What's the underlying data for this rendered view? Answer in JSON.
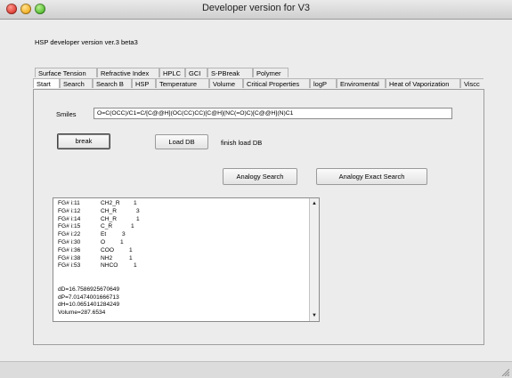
{
  "window": {
    "title": "Developer version for V3"
  },
  "subtitle": "HSP developer version ver.3 beta3",
  "tabs_row1": [
    "Surface Tension",
    "Refractive Index",
    "HPLC",
    "GCI",
    "S-PBreak",
    "Polymer"
  ],
  "tabs_row2": [
    "Start",
    "Search",
    "Search B",
    "HSP",
    "Temperature",
    "Volume",
    "Critical Properties",
    "logP",
    "Enviromental",
    "Heat of Vaporization",
    "Viscc"
  ],
  "active_tab": "Start",
  "smiles": {
    "label": "Smiles",
    "value": "O=C(OCC)/C1=C/[C@@H](OC(CC)CC)[C@H](NC(=O)C)[C@@H](N)C1"
  },
  "buttons": {
    "break": "break",
    "load_db": "Load DB",
    "analogy_search": "Analogy Search",
    "analogy_exact_search": "Analogy Exact Search"
  },
  "status": {
    "finish_load_db": "finish load DB"
  },
  "output": {
    "fg_lines": [
      [
        "FG# i:11",
        "CH2_R",
        "1"
      ],
      [
        "FG# i:12",
        "CH_R",
        "3"
      ],
      [
        "FG# i:14",
        "CH_R",
        "1"
      ],
      [
        "FG# i:15",
        "C_R",
        "1"
      ],
      [
        "FG# i:22",
        "Et",
        "3"
      ],
      [
        "FG# i:30",
        "O",
        "1"
      ],
      [
        "FG# i:36",
        "COO",
        "1"
      ],
      [
        "FG# i:38",
        "NH2",
        "1"
      ],
      [
        "FG# i:53",
        "NHCO",
        "1"
      ]
    ],
    "property_lines": [
      "dD=16.7586925670649",
      "dP=7.01474001666713",
      "dH=10.0651401284249",
      "Volume=287.6534"
    ]
  },
  "scrollbar": {
    "up_arrow": "▲",
    "down_arrow": "▼"
  },
  "icons": {
    "close": "close-icon",
    "minimize": "minimize-icon",
    "maximize": "maximize-icon",
    "resize": "resize-grip-icon"
  }
}
